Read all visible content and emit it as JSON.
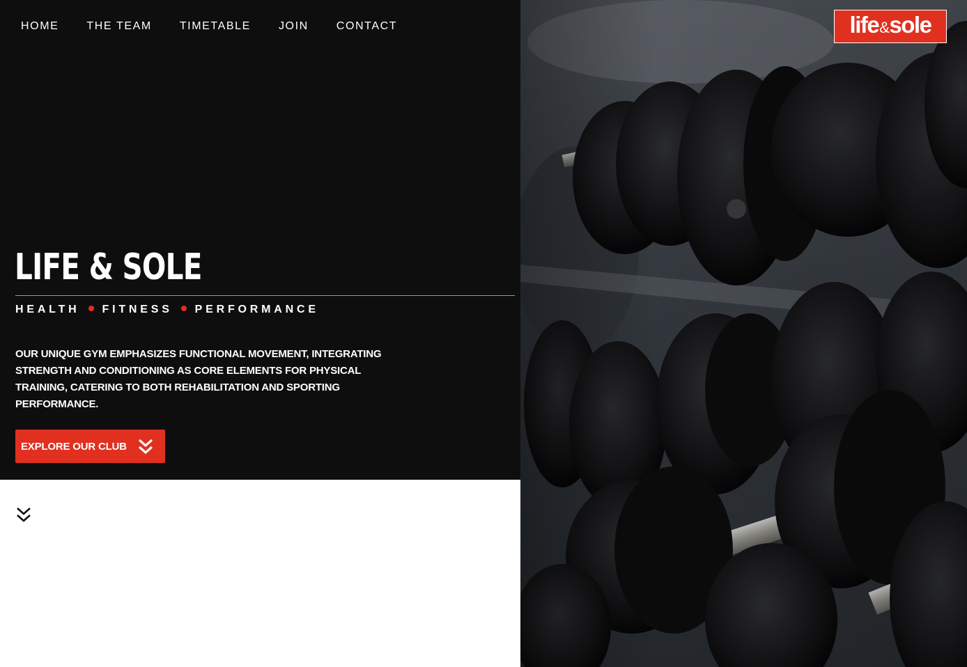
{
  "nav": {
    "items": [
      "HOME",
      "THE TEAM",
      "TIMETABLE",
      "JOIN",
      "CONTACT"
    ]
  },
  "hero": {
    "title": "LIFE & SOLE",
    "tagline": [
      "HEALTH",
      "FITNESS",
      "PERFORMANCE"
    ],
    "description": "OUR UNIQUE GYM EMPHASIZES FUNCTIONAL MOVEMENT, INTEGRATING STRENGTH AND CONDITIONING AS CORE ELEMENTS FOR PHYSICAL TRAINING, CATERING TO BOTH REHABILITATION AND SPORTING PERFORMANCE.",
    "cta_label": "EXPLORE OUR CLUB",
    "cta_icon": "double-chevron-down-icon",
    "image": "dumbbell-rack-photo"
  },
  "logo": {
    "part1": "life",
    "amp": "&",
    "part2": "sole"
  },
  "scroll": {
    "icon": "double-chevron-down-icon"
  },
  "colors": {
    "accent": "#e1301f",
    "panel": "#0e0e0f",
    "text": "#ffffff"
  }
}
